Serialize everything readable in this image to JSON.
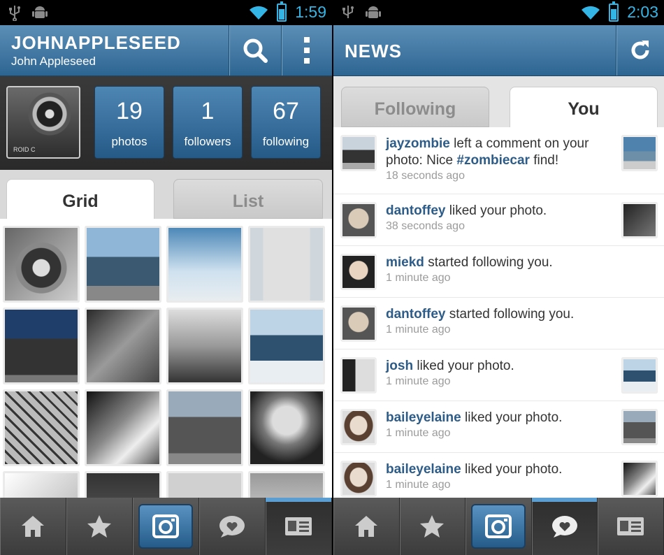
{
  "left": {
    "status_time": "1:59",
    "header": {
      "title": "JOHNAPPLESEED",
      "subtitle": "John Appleseed"
    },
    "stats": [
      {
        "value": "19",
        "label": "photos"
      },
      {
        "value": "1",
        "label": "followers"
      },
      {
        "value": "67",
        "label": "following"
      }
    ],
    "avatar_text": "ROID C",
    "tabs": {
      "grid": "Grid",
      "list": "List"
    }
  },
  "right": {
    "status_time": "2:03",
    "header": {
      "title": "NEWS"
    },
    "tabs": {
      "following": "Following",
      "you": "You"
    },
    "feed": [
      {
        "user": "jayzombie",
        "pre": " left a comment on your photo: Nice ",
        "tag": "#zombiecar",
        "post": " find!",
        "time": "18 seconds ago"
      },
      {
        "user": "dantoffey",
        "pre": " liked your photo.",
        "time": "38 seconds ago"
      },
      {
        "user": "miekd",
        "pre": " started following you.",
        "time": "1 minute ago"
      },
      {
        "user": "dantoffey",
        "pre": " started following you.",
        "time": "1 minute ago"
      },
      {
        "user": "josh",
        "pre": " liked your photo.",
        "time": "1 minute ago"
      },
      {
        "user": "baileyelaine",
        "pre": " liked your photo.",
        "time": "1 minute ago"
      },
      {
        "user": "baileyelaine",
        "pre": " liked your photo.",
        "time": "1 minute ago"
      }
    ]
  },
  "colors": {
    "accent": "#33b5e5",
    "header_blue": "#3d73a0",
    "link": "#2d5c88"
  },
  "icons": [
    "usb-icon",
    "android-debug-icon",
    "wifi-icon",
    "battery-icon",
    "search-icon",
    "overflow-menu-icon",
    "refresh-icon",
    "home-icon",
    "star-icon",
    "camera-icon",
    "heart-bubble-icon",
    "profile-card-icon"
  ]
}
